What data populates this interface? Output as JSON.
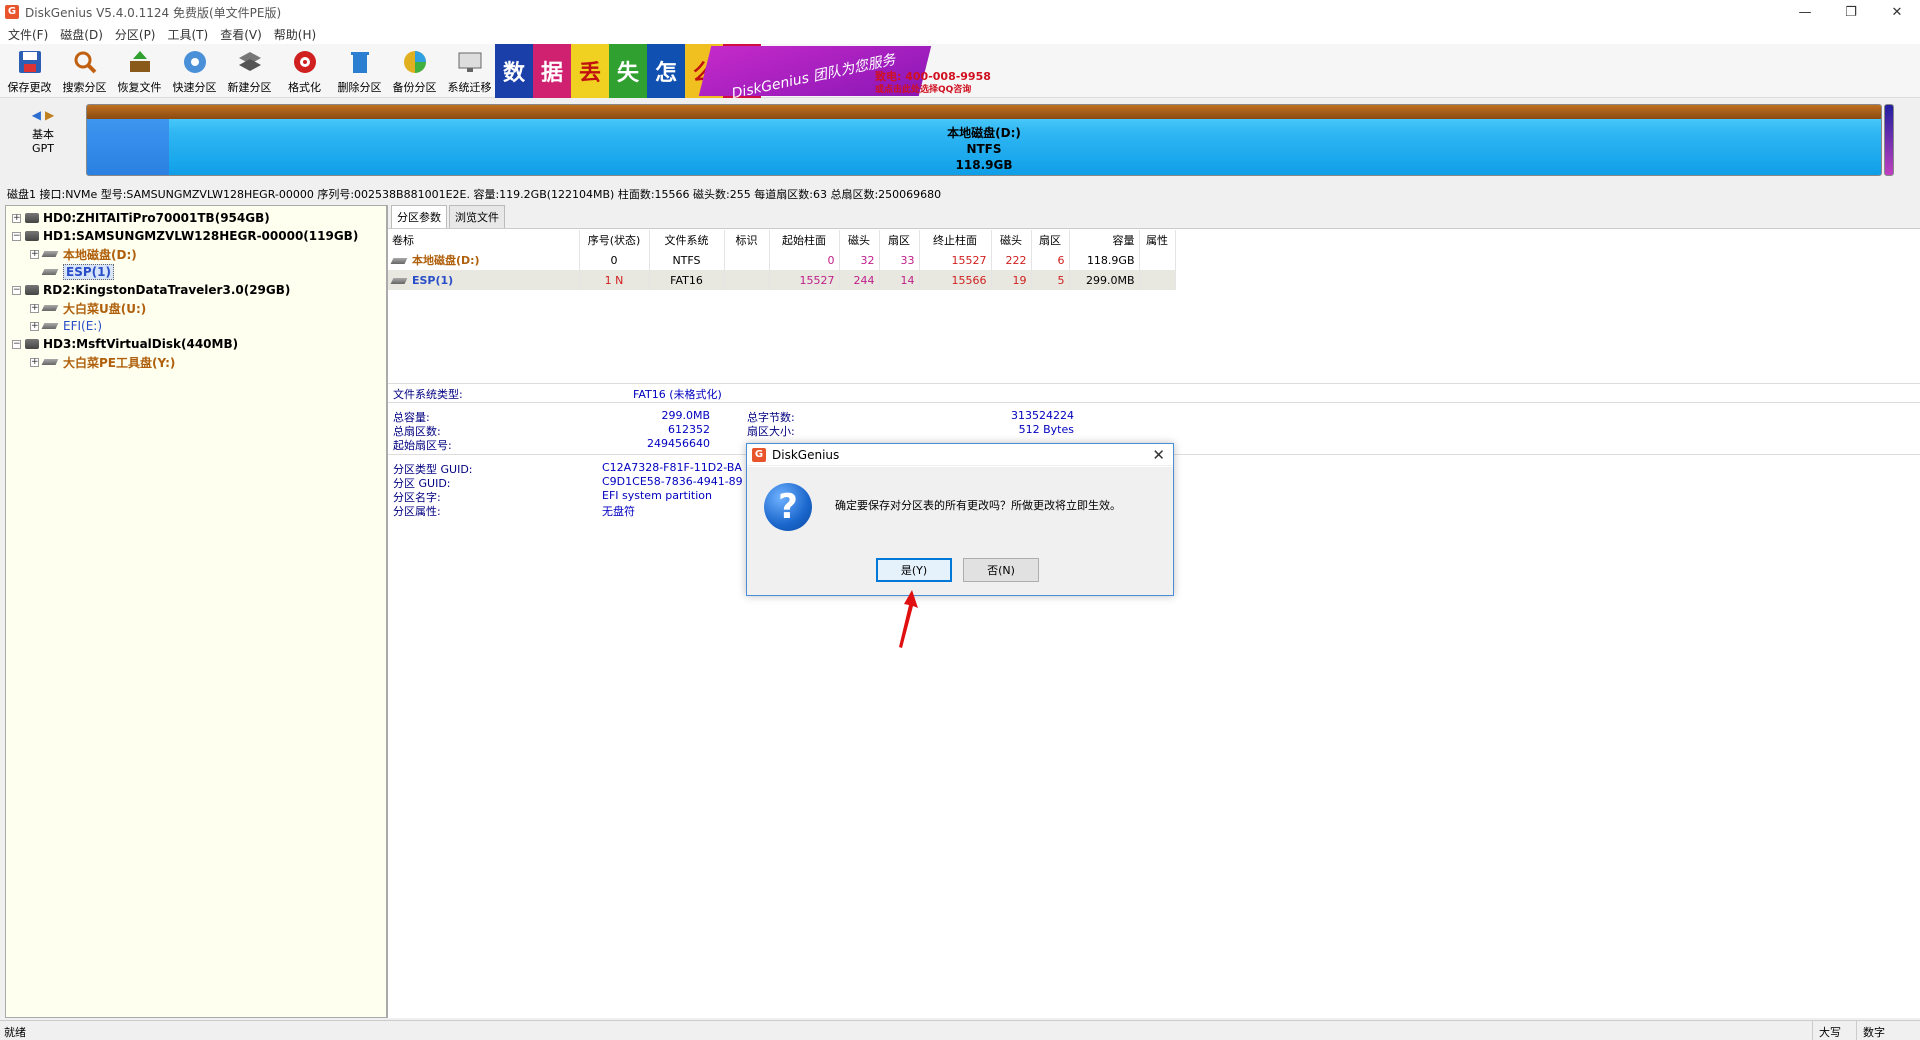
{
  "window": {
    "title": "DiskGenius V5.4.0.1124 免费版(单文件PE版)",
    "minimize": "—",
    "maximize": "❐",
    "close": "✕"
  },
  "menu": [
    "文件(F)",
    "磁盘(D)",
    "分区(P)",
    "工具(T)",
    "查看(V)",
    "帮助(H)"
  ],
  "toolbar": [
    {
      "label": "保存更改",
      "icon": "save-icon"
    },
    {
      "label": "搜索分区",
      "icon": "search-icon"
    },
    {
      "label": "恢复文件",
      "icon": "recover-icon"
    },
    {
      "label": "快速分区",
      "icon": "quick-partition-icon"
    },
    {
      "label": "新建分区",
      "icon": "new-partition-icon"
    },
    {
      "label": "格式化",
      "icon": "format-icon"
    },
    {
      "label": "删除分区",
      "icon": "delete-icon"
    },
    {
      "label": "备份分区",
      "icon": "backup-icon"
    },
    {
      "label": "系统迁移",
      "icon": "migrate-icon"
    }
  ],
  "banner": {
    "chars": [
      "数",
      "据",
      "丢",
      "失",
      "怎",
      "么",
      "办"
    ],
    "brand": "DiskGenius 团队为您服务",
    "phone": "致电: 400-008-9958",
    "qq": "或点击此处选择QQ咨询"
  },
  "diskmap": {
    "type_line1": "基本",
    "type_line2": "GPT",
    "part_name": "本地磁盘(D:)",
    "part_fs": "NTFS",
    "part_size": "118.9GB"
  },
  "disk_info": "磁盘1 接口:NVMe  型号:SAMSUNGMZVLW128HEGR-00000  序列号:002538B881001E2E.  容量:119.2GB(122104MB)  柱面数:15566  磁头数:255  每道扇区数:63  总扇区数:250069680",
  "tree": {
    "hd0": "HD0:ZHITAITiPro70001TB(954GB)",
    "hd1": "HD1:SAMSUNGMZVLW128HEGR-00000(119GB)",
    "hd1_p1": "本地磁盘(D:)",
    "hd1_p2": "ESP(1)",
    "rd2": "RD2:KingstonDataTraveler3.0(29GB)",
    "rd2_p1": "大白菜U盘(U:)",
    "rd2_p2": "EFI(E:)",
    "hd3": "HD3:MsftVirtualDisk(440MB)",
    "hd3_p1": "大白菜PE工具盘(Y:)"
  },
  "tabs": [
    "分区参数",
    "浏览文件"
  ],
  "table": {
    "headers": [
      "卷标",
      "序号(状态)",
      "文件系统",
      "标识",
      "起始柱面",
      "磁头",
      "扇区",
      "终止柱面",
      "磁头",
      "扇区",
      "容量",
      "属性"
    ],
    "rows": [
      [
        "本地磁盘(D:)",
        "0",
        "NTFS",
        "",
        "0",
        "32",
        "33",
        "15527",
        "222",
        "6",
        "118.9GB",
        ""
      ],
      [
        "ESP(1)",
        "1 N",
        "FAT16",
        "",
        "15527",
        "244",
        "14",
        "15566",
        "19",
        "5",
        "299.0MB",
        ""
      ]
    ]
  },
  "details": {
    "fs_type_label": "文件系统类型:",
    "fs_type_value": "FAT16 (未格式化)",
    "total_cap_label": "总容量:",
    "total_cap_value": "299.0MB",
    "total_bytes_label": "总字节数:",
    "total_bytes_value": "313524224",
    "total_sectors_label": "总扇区数:",
    "total_sectors_value": "612352",
    "sector_size_label": "扇区大小:",
    "sector_size_value": "512 Bytes",
    "start_sector_label": "起始扇区号:",
    "start_sector_value": "249456640",
    "type_guid_label": "分区类型 GUID:",
    "type_guid_value": "C12A7328-F81F-11D2-BA",
    "guid_label": "分区 GUID:",
    "guid_value": "C9D1CE58-7836-4941-89",
    "name_label": "分区名字:",
    "name_value": "EFI system partition",
    "attr_label": "分区属性:",
    "attr_value": "无盘符"
  },
  "dialog": {
    "title": "DiskGenius",
    "message": "确定要保存对分区表的所有更改吗？所做更改将立即生效。",
    "yes": "是(Y)",
    "no": "否(N)",
    "close": "✕"
  },
  "status": {
    "text": "就绪",
    "caps": "大写",
    "num": "数字"
  }
}
